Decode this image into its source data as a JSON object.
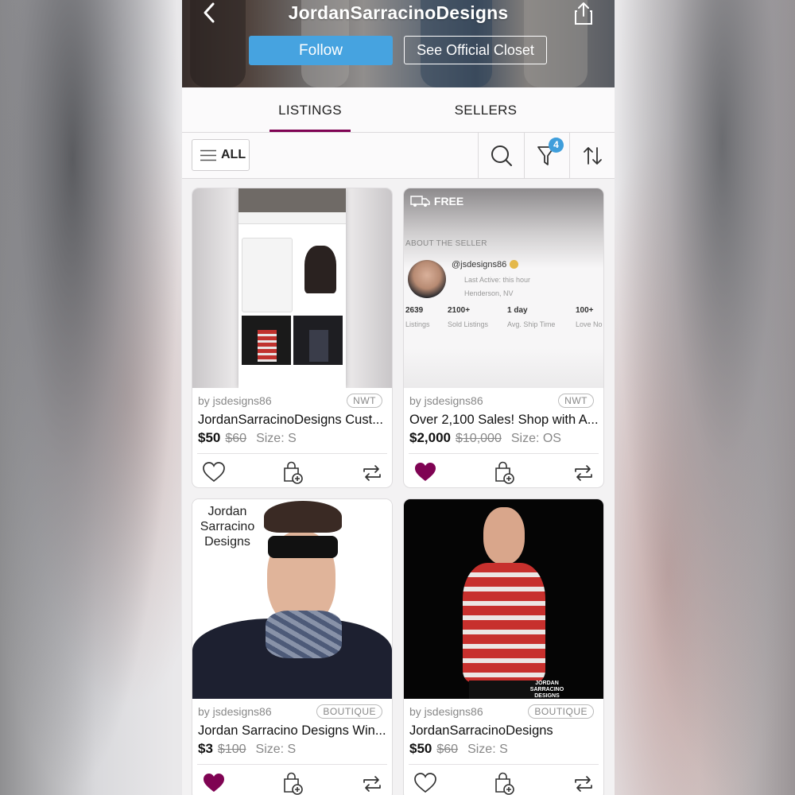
{
  "header": {
    "title": "JordanSarracinoDesigns",
    "follow_label": "Follow",
    "closet_label": "See Official Closet"
  },
  "tabs": [
    {
      "label": "LISTINGS",
      "active": true
    },
    {
      "label": "SELLERS",
      "active": false
    }
  ],
  "filter_bar": {
    "all_label": "ALL",
    "filter_count": "4",
    "icons": [
      "menu-lines-icon",
      "search-icon",
      "filter-funnel-icon",
      "sort-arrows-icon"
    ]
  },
  "colors": {
    "accent": "#7f0353",
    "follow_blue": "#46a3e0",
    "badge_blue": "#3f9edb"
  },
  "listings": [
    {
      "seller": "by jsdesigns86",
      "condition": "NWT",
      "title": "JordanSarracinoDesigns Cust...",
      "price": "$50",
      "original_price": "$60",
      "size": "Size: S",
      "liked": false
    },
    {
      "seller": "by jsdesigns86",
      "condition": "NWT",
      "title": "Over 2,100 Sales! Shop with A...",
      "price": "$2,000",
      "original_price": "$10,000",
      "size": "Size: OS",
      "liked": true,
      "image": {
        "free_label": "FREE",
        "section_label": "ABOUT THE SELLER",
        "handle": "@jsdesigns86",
        "last_active": "Last Active: this hour",
        "location": "Henderson, NV",
        "stats": [
          {
            "value": "2639",
            "label": "Listings"
          },
          {
            "value": "2100+",
            "label": "Sold Listings"
          },
          {
            "value": "1 day",
            "label": "Avg. Ship Time"
          },
          {
            "value": "100+",
            "label": "Love No"
          }
        ]
      }
    },
    {
      "seller": "by jsdesigns86",
      "condition": "BOUTIQUE",
      "title": "Jordan Sarracino Designs Win...",
      "price": "$3",
      "original_price": "$100",
      "size": "Size: S",
      "liked": true,
      "image": {
        "overlay_text": "Jordan Sarracino Designs"
      }
    },
    {
      "seller": "by jsdesigns86",
      "condition": "BOUTIQUE",
      "title": "JordanSarracinoDesigns",
      "price": "$50",
      "original_price": "$60",
      "size": "Size: S",
      "liked": false,
      "image": {
        "overlay_text": "JORDAN SARRACINO DESIGNS"
      }
    }
  ]
}
